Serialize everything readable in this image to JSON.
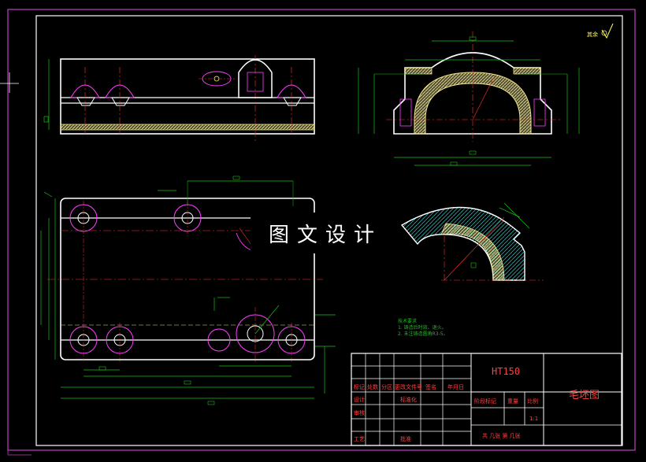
{
  "watermark": "图文设计",
  "roughness_symbol": "其余",
  "material": "HT150",
  "drawing_title": "毛坯图",
  "technical_notes": {
    "heading": "技术要求",
    "line1": "1. 铸造后时效、退火。",
    "line2": "2. 未注铸造圆角R3-5。"
  },
  "title_block": {
    "row_labels": [
      "标记",
      "处数",
      "分区",
      "更改文件号",
      "签名",
      "年月日"
    ],
    "design": "设计",
    "review": "审核",
    "process": "工艺",
    "standardize": "标准化",
    "approve": "批准",
    "stage_mark": "阶段标记",
    "weight": "重量",
    "scale": "比例",
    "scale_value": "1:1",
    "sheet_info": "共  几张  第  几张"
  },
  "colors": {
    "outline": "#ffffff",
    "hatch": "#f2e68a",
    "dimension": "#18c018",
    "center_line": "#ff3030",
    "hidden": "#ff40ff",
    "frame": "#c040c0",
    "title_text": "#ff4040",
    "cyan_hatch": "#30c8c8"
  }
}
